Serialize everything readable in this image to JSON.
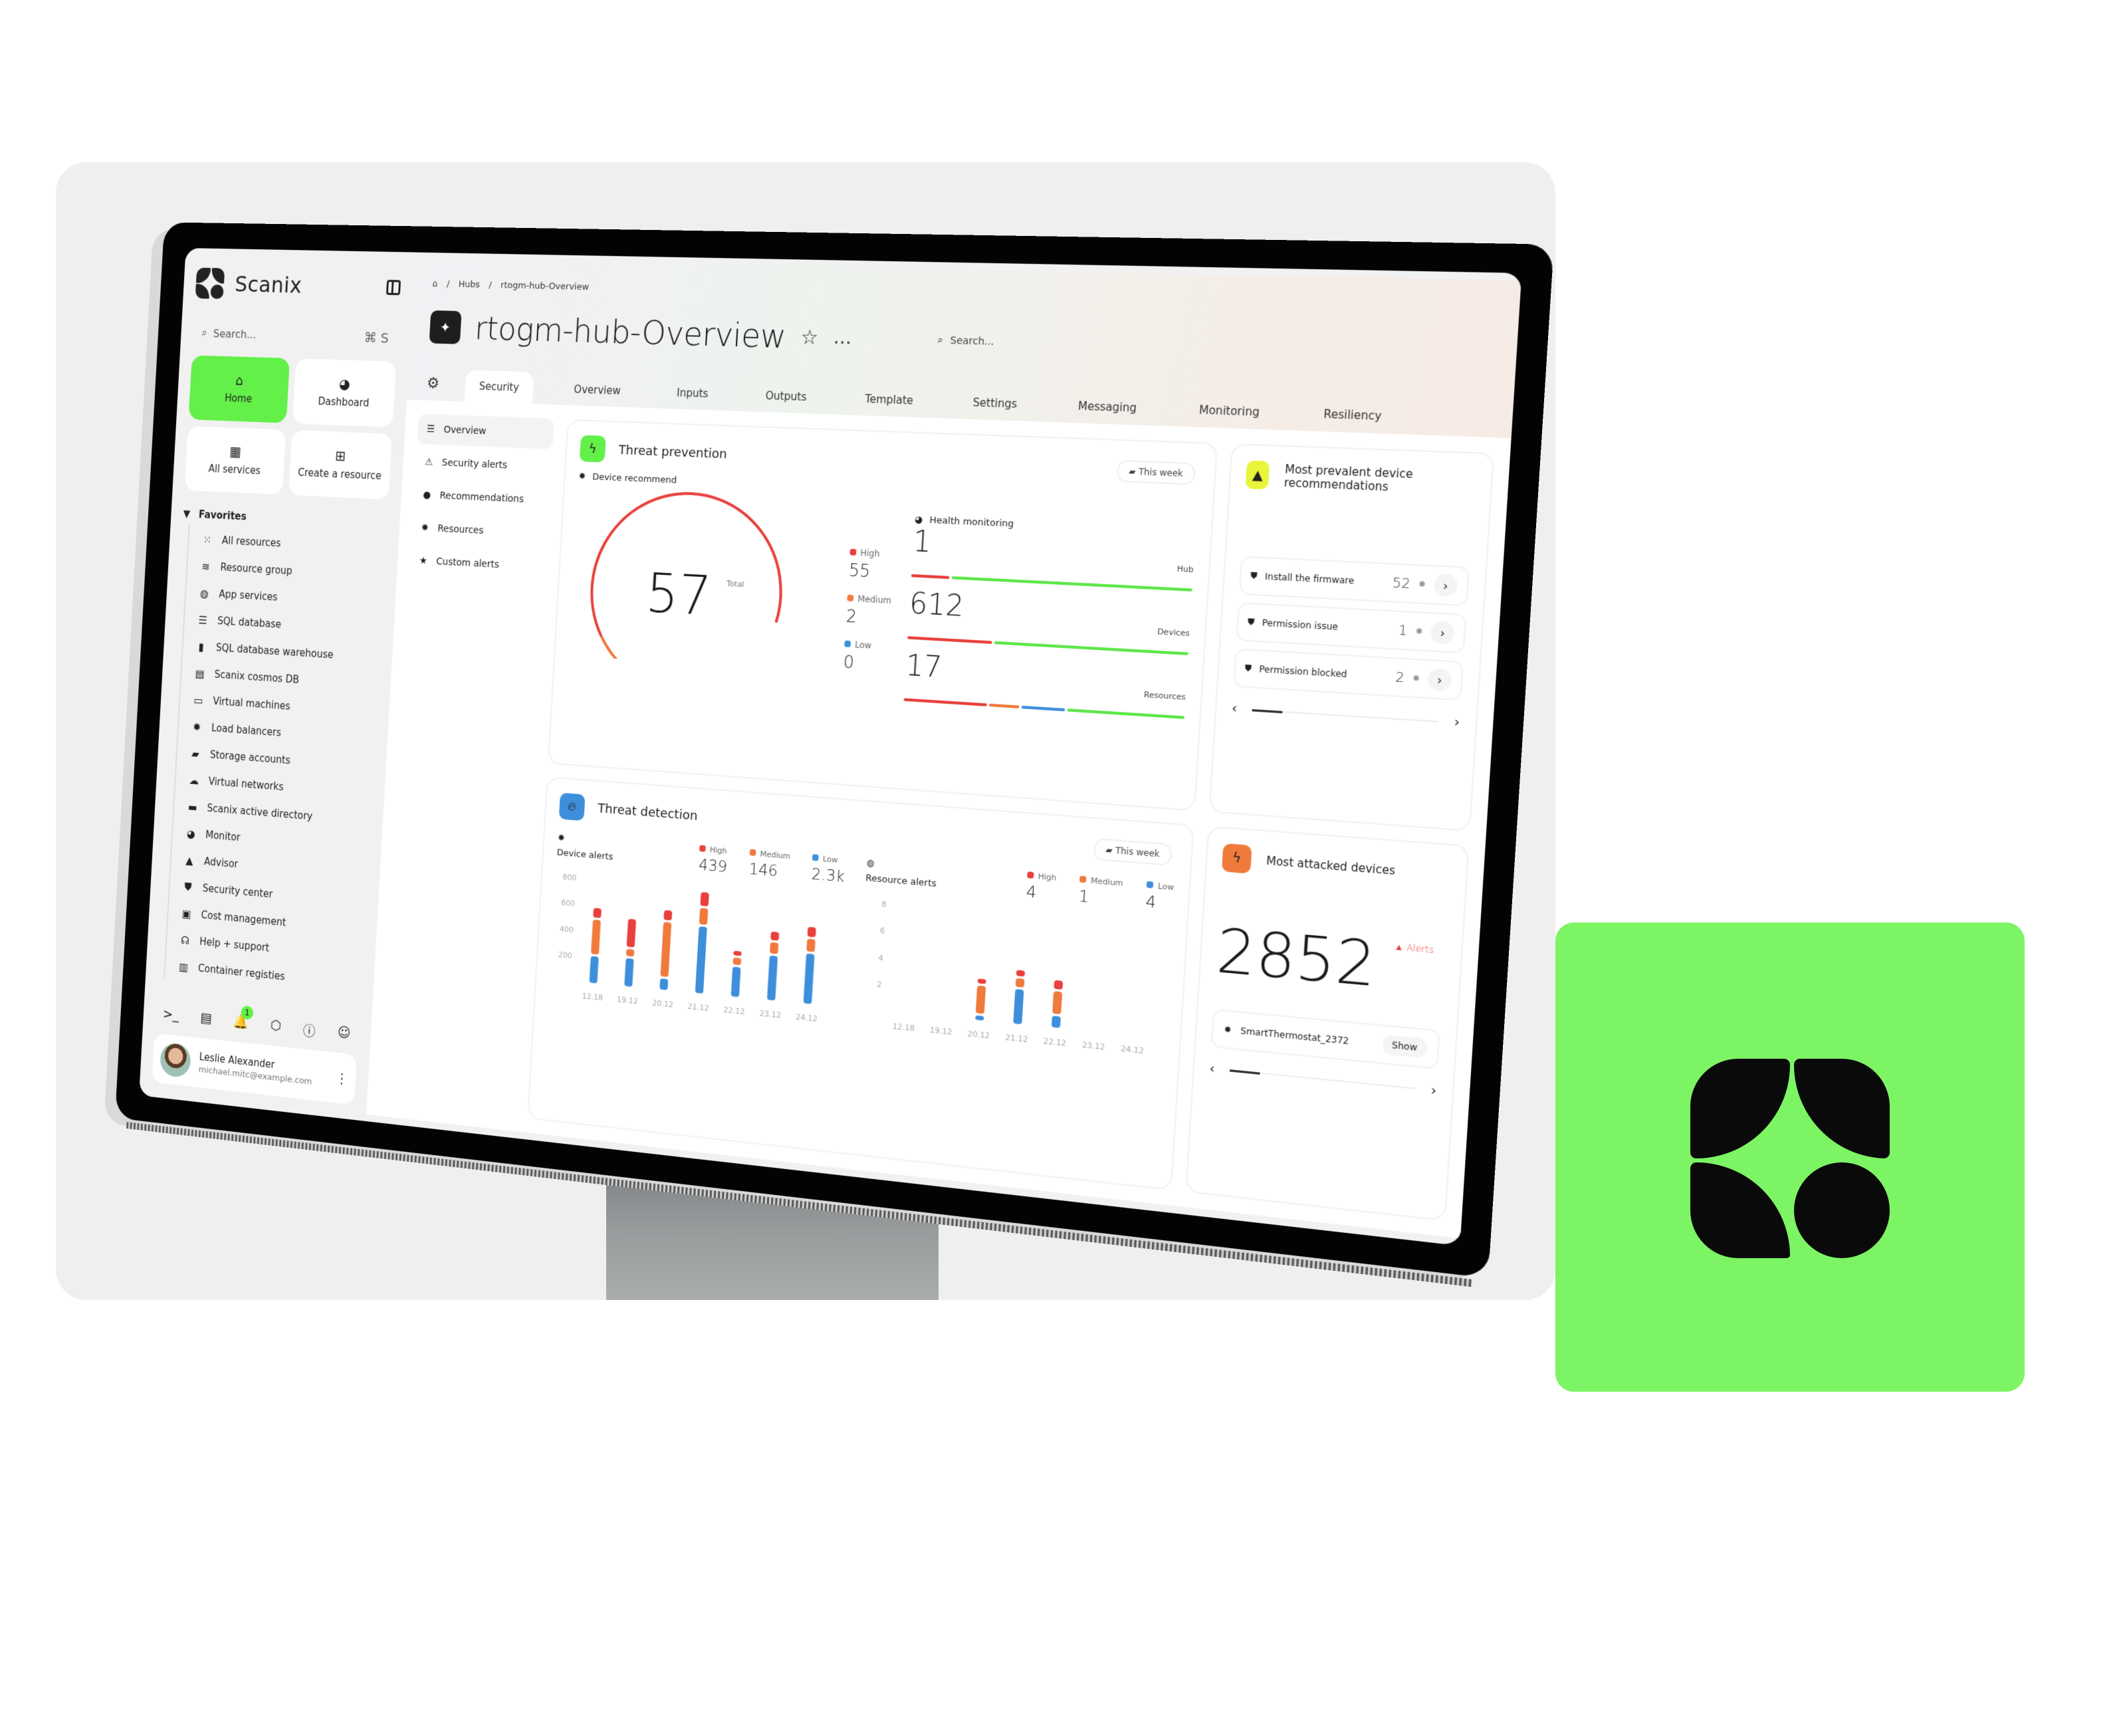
{
  "colors": {
    "brand_green": "#7df464",
    "accent_green": "#62f049",
    "high": "#e8403c",
    "medium": "#f07a3c",
    "low": "#3d8fdb",
    "ok": "#5ee64a",
    "yellow": "#e8f53a"
  },
  "sidebar": {
    "brand": "Scanix",
    "search_placeholder": "Search...",
    "search_shortcut": "⌘ S",
    "quick": [
      {
        "label": "Home",
        "icon": "home-icon",
        "glyph": "⌂",
        "active": true
      },
      {
        "label": "Dashboard",
        "icon": "pie-chart-icon",
        "glyph": "◕"
      },
      {
        "label": "All services",
        "icon": "grid-icon",
        "glyph": "▦"
      },
      {
        "label": "Create a resource",
        "icon": "plus-square-icon",
        "glyph": "⊞"
      }
    ],
    "favorites_label": "Favorites",
    "favorites": [
      {
        "label": "All resources",
        "icon": "grid-dots-icon",
        "glyph": "⁙"
      },
      {
        "label": "Resource group",
        "icon": "layers-icon",
        "glyph": "≋"
      },
      {
        "label": "App services",
        "icon": "globe-icon",
        "glyph": "◍"
      },
      {
        "label": "SQL database",
        "icon": "database-icon",
        "glyph": "☰"
      },
      {
        "label": "SQL database warehouse",
        "icon": "device-icon",
        "glyph": "▮"
      },
      {
        "label": "Scanix cosmos DB",
        "icon": "server-icon",
        "glyph": "▤"
      },
      {
        "label": "Virtual machines",
        "icon": "monitor-icon",
        "glyph": "▭"
      },
      {
        "label": "Load balancers",
        "icon": "chip-icon",
        "glyph": "✹"
      },
      {
        "label": "Storage accounts",
        "icon": "folder-icon",
        "glyph": "▰"
      },
      {
        "label": "Virtual networks",
        "icon": "cloud-icon",
        "glyph": "☁"
      },
      {
        "label": "Scanix active directory",
        "icon": "drive-icon",
        "glyph": "▬"
      },
      {
        "label": "Monitor",
        "icon": "pie-chart-icon",
        "glyph": "◕"
      },
      {
        "label": "Advisor",
        "icon": "graduation-cap-icon",
        "glyph": "▲"
      },
      {
        "label": "Security center",
        "icon": "shield-icon",
        "glyph": "⛊"
      },
      {
        "label": "Cost management",
        "icon": "receipt-icon",
        "glyph": "▣"
      },
      {
        "label": "Help + support",
        "icon": "headset-icon",
        "glyph": "☊"
      },
      {
        "label": "Container registies",
        "icon": "container-icon",
        "glyph": "▥"
      }
    ],
    "bottom_icons": [
      {
        "name": "terminal-icon",
        "glyph": ">_"
      },
      {
        "name": "book-icon",
        "glyph": "▤"
      },
      {
        "name": "bell-icon",
        "glyph": "🔔",
        "badge": "1"
      },
      {
        "name": "settings-icon",
        "glyph": "⬡"
      },
      {
        "name": "info-icon",
        "glyph": "ⓘ"
      },
      {
        "name": "feedback-icon",
        "glyph": "☺"
      }
    ],
    "user": {
      "name": "Leslie Alexander",
      "email": "michael.mitc@example.com"
    }
  },
  "header": {
    "breadcrumb": [
      "Hubs",
      "rtogm-hub-Overview"
    ],
    "title": "rtogm-hub-Overview",
    "search_placeholder": "Search..."
  },
  "tabs": [
    "Security",
    "Overview",
    "Inputs",
    "Outputs",
    "Template",
    "Settings",
    "Messaging",
    "Monitoring",
    "Resiliency"
  ],
  "active_tab": "Security",
  "subnav": [
    {
      "label": "Overview",
      "glyph": "☰",
      "icon": "list-icon",
      "active": true
    },
    {
      "label": "Security alerts",
      "glyph": "⚠",
      "icon": "warning-icon"
    },
    {
      "label": "Recommendations",
      "glyph": "●",
      "icon": "lightbulb-icon"
    },
    {
      "label": "Resources",
      "glyph": "✹",
      "icon": "gear-icon"
    },
    {
      "label": "Custom alerts",
      "glyph": "★",
      "icon": "star-icon"
    }
  ],
  "threat_prevention": {
    "title": "Threat prevention",
    "period": "This week",
    "device_recommend": {
      "label": "Device recommend",
      "total": "57",
      "total_label": "Total",
      "high_label": "High",
      "high": "55",
      "medium_label": "Medium",
      "medium": "2",
      "low_label": "Low",
      "low": "0",
      "high_value": 55,
      "medium_value": 2,
      "low_value": 0
    },
    "health_monitoring": {
      "label": "Health monitoring",
      "rows": [
        {
          "value": "1",
          "label": "Hub",
          "segments": [
            {
              "color": "high",
              "frac": 0.14
            },
            {
              "color": "ok",
              "frac": 0.86
            }
          ]
        },
        {
          "value": "612",
          "label": "Devices",
          "segments": [
            {
              "color": "high",
              "frac": 0.31
            },
            {
              "color": "ok",
              "frac": 0.69
            }
          ]
        },
        {
          "value": "17",
          "label": "Resources",
          "segments": [
            {
              "color": "high",
              "frac": 0.31
            },
            {
              "color": "medium",
              "frac": 0.11
            },
            {
              "color": "low",
              "frac": 0.16
            },
            {
              "color": "ok",
              "frac": 0.42
            }
          ]
        }
      ]
    }
  },
  "recommendations": {
    "title": "Most prevalent device recommendations",
    "items": [
      {
        "label": "Install the firmware",
        "count": "52"
      },
      {
        "label": "Permission issue",
        "count": "1"
      },
      {
        "label": "Permission blocked",
        "count": "2"
      }
    ],
    "page_position": 0.0
  },
  "threat_detection": {
    "title": "Threat detection",
    "period": "This week"
  },
  "most_attacked": {
    "title": "Most attacked devices",
    "count": "2852",
    "alerts_label": "Alerts",
    "device": "SmartThermostat_2372",
    "show_label": "Show"
  },
  "chart_data": [
    {
      "type": "bar",
      "stacked": true,
      "title": "Device alerts",
      "categories": [
        "12.18",
        "19.12",
        "20.12",
        "21.12",
        "22.12",
        "23.12",
        "24.12"
      ],
      "series": [
        {
          "name": "Low",
          "color": "#3d8fdb",
          "values": [
            220,
            230,
            100,
            520,
            240,
            350,
            390
          ]
        },
        {
          "name": "Medium",
          "color": "#f07a3c",
          "values": [
            280,
            70,
            430,
            140,
            70,
            100,
            110
          ]
        },
        {
          "name": "High",
          "color": "#e8403c",
          "values": [
            90,
            230,
            90,
            120,
            50,
            80,
            90
          ]
        }
      ],
      "totals_legend": [
        {
          "name": "High",
          "value": "439"
        },
        {
          "name": "Medium",
          "value": "146"
        },
        {
          "name": "Low",
          "value": "2.3k"
        }
      ],
      "yticks": [
        200,
        400,
        600,
        800
      ],
      "ylim": [
        0,
        800
      ],
      "grid": false,
      "legend": "top-right"
    },
    {
      "type": "bar",
      "stacked": true,
      "title": "Resource alerts",
      "categories": [
        "12.18",
        "19.12",
        "20.12",
        "21.12",
        "22.12",
        "23.12",
        "24.12"
      ],
      "series": [
        {
          "name": "Low",
          "color": "#3d8fdb",
          "values": [
            0,
            0,
            0.5,
            2.7,
            1,
            0,
            0
          ]
        },
        {
          "name": "Medium",
          "color": "#f07a3c",
          "values": [
            0,
            0,
            2.2,
            0.8,
            1.8,
            0,
            0
          ]
        },
        {
          "name": "High",
          "color": "#e8403c",
          "values": [
            0,
            0,
            0.5,
            0.6,
            0.8,
            0,
            0
          ]
        }
      ],
      "totals_legend": [
        {
          "name": "High",
          "value": "4"
        },
        {
          "name": "Medium",
          "value": "1"
        },
        {
          "name": "Low",
          "value": "4"
        }
      ],
      "yticks": [
        2,
        4,
        6,
        8
      ],
      "ylim": [
        0,
        8
      ],
      "grid": false,
      "legend": "top-right"
    }
  ]
}
